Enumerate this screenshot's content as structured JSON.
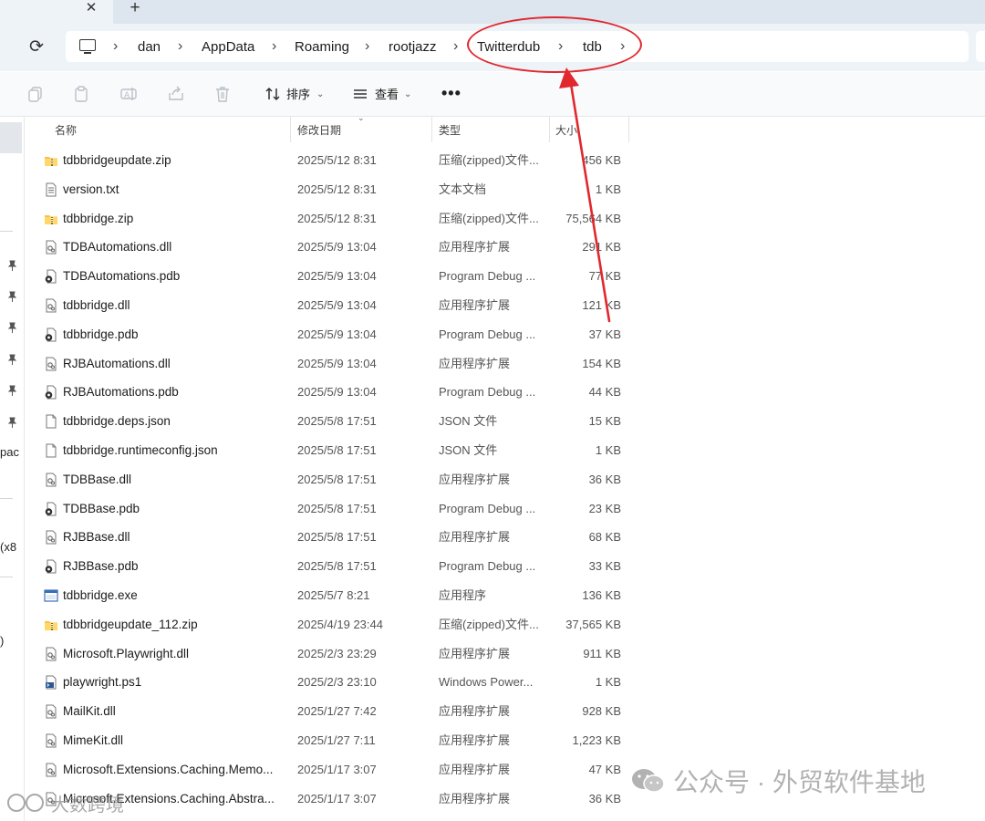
{
  "tabs": {
    "close_glyph": "✕",
    "new_tab_glyph": "+"
  },
  "address_bar": {
    "refresh_glyph": "⟳",
    "separator_glyph": "›",
    "crumbs": [
      "dan",
      "AppData",
      "Roaming",
      "rootjazz",
      "Twitterdub",
      "tdb"
    ]
  },
  "toolbar": {
    "icons": [
      "copy-icon",
      "paste-icon",
      "rename-icon",
      "share-icon",
      "delete-icon"
    ],
    "sort_label": "排序",
    "view_label": "查看",
    "more_label": "•••"
  },
  "nav_pane": {
    "visible_fragments": [
      "pac",
      "(x8",
      ")"
    ]
  },
  "columns": {
    "name": "名称",
    "date": "修改日期",
    "type": "类型",
    "size": "大小"
  },
  "files": [
    {
      "name": "tdbbridgeupdate.zip",
      "date": "2025/5/12 8:31",
      "type": "压缩(zipped)文件...",
      "size": "456 KB",
      "icon": "zip-folder-icon"
    },
    {
      "name": "version.txt",
      "date": "2025/5/12 8:31",
      "type": "文本文档",
      "size": "1 KB",
      "icon": "text-file-icon"
    },
    {
      "name": "tdbbridge.zip",
      "date": "2025/5/12 8:31",
      "type": "压缩(zipped)文件...",
      "size": "75,564 KB",
      "icon": "zip-folder-icon"
    },
    {
      "name": "TDBAutomations.dll",
      "date": "2025/5/9 13:04",
      "type": "应用程序扩展",
      "size": "291 KB",
      "icon": "dll-file-icon"
    },
    {
      "name": "TDBAutomations.pdb",
      "date": "2025/5/9 13:04",
      "type": "Program Debug ...",
      "size": "77 KB",
      "icon": "pdb-file-icon"
    },
    {
      "name": "tdbbridge.dll",
      "date": "2025/5/9 13:04",
      "type": "应用程序扩展",
      "size": "121 KB",
      "icon": "dll-file-icon"
    },
    {
      "name": "tdbbridge.pdb",
      "date": "2025/5/9 13:04",
      "type": "Program Debug ...",
      "size": "37 KB",
      "icon": "pdb-file-icon"
    },
    {
      "name": "RJBAutomations.dll",
      "date": "2025/5/9 13:04",
      "type": "应用程序扩展",
      "size": "154 KB",
      "icon": "dll-file-icon"
    },
    {
      "name": "RJBAutomations.pdb",
      "date": "2025/5/9 13:04",
      "type": "Program Debug ...",
      "size": "44 KB",
      "icon": "pdb-file-icon"
    },
    {
      "name": "tdbbridge.deps.json",
      "date": "2025/5/8 17:51",
      "type": "JSON 文件",
      "size": "15 KB",
      "icon": "json-file-icon"
    },
    {
      "name": "tdbbridge.runtimeconfig.json",
      "date": "2025/5/8 17:51",
      "type": "JSON 文件",
      "size": "1 KB",
      "icon": "json-file-icon"
    },
    {
      "name": "TDBBase.dll",
      "date": "2025/5/8 17:51",
      "type": "应用程序扩展",
      "size": "36 KB",
      "icon": "dll-file-icon"
    },
    {
      "name": "TDBBase.pdb",
      "date": "2025/5/8 17:51",
      "type": "Program Debug ...",
      "size": "23 KB",
      "icon": "pdb-file-icon"
    },
    {
      "name": "RJBBase.dll",
      "date": "2025/5/8 17:51",
      "type": "应用程序扩展",
      "size": "68 KB",
      "icon": "dll-file-icon"
    },
    {
      "name": "RJBBase.pdb",
      "date": "2025/5/8 17:51",
      "type": "Program Debug ...",
      "size": "33 KB",
      "icon": "pdb-file-icon"
    },
    {
      "name": "tdbbridge.exe",
      "date": "2025/5/7 8:21",
      "type": "应用程序",
      "size": "136 KB",
      "icon": "exe-file-icon"
    },
    {
      "name": "tdbbridgeupdate_112.zip",
      "date": "2025/4/19 23:44",
      "type": "压缩(zipped)文件...",
      "size": "37,565 KB",
      "icon": "zip-folder-icon"
    },
    {
      "name": "Microsoft.Playwright.dll",
      "date": "2025/2/3 23:29",
      "type": "应用程序扩展",
      "size": "911 KB",
      "icon": "dll-file-icon"
    },
    {
      "name": "playwright.ps1",
      "date": "2025/2/3 23:10",
      "type": "Windows Power...",
      "size": "1 KB",
      "icon": "powershell-file-icon"
    },
    {
      "name": "MailKit.dll",
      "date": "2025/1/27 7:42",
      "type": "应用程序扩展",
      "size": "928 KB",
      "icon": "dll-file-icon"
    },
    {
      "name": "MimeKit.dll",
      "date": "2025/1/27 7:11",
      "type": "应用程序扩展",
      "size": "1,223 KB",
      "icon": "dll-file-icon"
    },
    {
      "name": "Microsoft.Extensions.Caching.Memo...",
      "date": "2025/1/17 3:07",
      "type": "应用程序扩展",
      "size": "47 KB",
      "icon": "dll-file-icon"
    },
    {
      "name": "Microsoft.Extensions.Caching.Abstra...",
      "date": "2025/1/17 3:07",
      "type": "应用程序扩展",
      "size": "36 KB",
      "icon": "dll-file-icon"
    }
  ],
  "annotation": {
    "color": "#e0282e"
  },
  "watermarks": {
    "right_text": "公众号 · 外贸软件基地",
    "left_text": "大数跨境"
  }
}
